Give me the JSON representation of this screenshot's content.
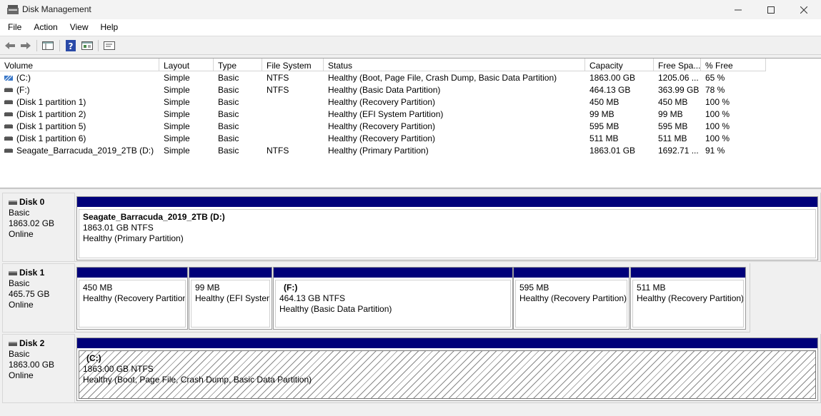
{
  "window": {
    "title": "Disk Management"
  },
  "menu": [
    "File",
    "Action",
    "View",
    "Help"
  ],
  "columns": [
    "Volume",
    "Layout",
    "Type",
    "File System",
    "Status",
    "Capacity",
    "Free Spa...",
    "% Free"
  ],
  "volumes": [
    {
      "volume": "(C:)",
      "layout": "Simple",
      "type": "Basic",
      "fs": "NTFS",
      "status": "Healthy (Boot, Page File, Crash Dump, Basic Data Partition)",
      "capacity": "1863.00 GB",
      "free": "1205.06 ...",
      "pct": "65 %",
      "icon": "striped-volume-icon"
    },
    {
      "volume": "(F:)",
      "layout": "Simple",
      "type": "Basic",
      "fs": "NTFS",
      "status": "Healthy (Basic Data Partition)",
      "capacity": "464.13 GB",
      "free": "363.99 GB",
      "pct": "78 %",
      "icon": "volume-icon"
    },
    {
      "volume": "(Disk 1 partition 1)",
      "layout": "Simple",
      "type": "Basic",
      "fs": "",
      "status": "Healthy (Recovery Partition)",
      "capacity": "450 MB",
      "free": "450 MB",
      "pct": "100 %",
      "icon": "volume-icon"
    },
    {
      "volume": "(Disk 1 partition 2)",
      "layout": "Simple",
      "type": "Basic",
      "fs": "",
      "status": "Healthy (EFI System Partition)",
      "capacity": "99 MB",
      "free": "99 MB",
      "pct": "100 %",
      "icon": "volume-icon"
    },
    {
      "volume": "(Disk 1 partition 5)",
      "layout": "Simple",
      "type": "Basic",
      "fs": "",
      "status": "Healthy (Recovery Partition)",
      "capacity": "595 MB",
      "free": "595 MB",
      "pct": "100 %",
      "icon": "volume-icon"
    },
    {
      "volume": "(Disk 1 partition 6)",
      "layout": "Simple",
      "type": "Basic",
      "fs": "",
      "status": "Healthy (Recovery Partition)",
      "capacity": "511 MB",
      "free": "511 MB",
      "pct": "100 %",
      "icon": "volume-icon"
    },
    {
      "volume": "Seagate_Barracuda_2019_2TB (D:)",
      "layout": "Simple",
      "type": "Basic",
      "fs": "NTFS",
      "status": "Healthy (Primary Partition)",
      "capacity": "1863.01 GB",
      "free": "1692.71 ...",
      "pct": "91 %",
      "icon": "volume-icon"
    }
  ],
  "disks": [
    {
      "name": "Disk 0",
      "type": "Basic",
      "size": "1863.02 GB",
      "state": "Online",
      "partitions": [
        {
          "title": "Seagate_Barracuda_2019_2TB  (D:)",
          "line1": "1863.01 GB NTFS",
          "line2": "Healthy (Primary Partition)"
        }
      ]
    },
    {
      "name": "Disk 1",
      "type": "Basic",
      "size": "465.75 GB",
      "state": "Online",
      "partitions": [
        {
          "title": "",
          "line1": "450 MB",
          "line2": "Healthy (Recovery Partition)"
        },
        {
          "title": "",
          "line1": "99 MB",
          "line2": "Healthy (EFI System Partition)"
        },
        {
          "title": "(F:)",
          "line1": "464.13 GB NTFS",
          "line2": "Healthy (Basic Data Partition)"
        },
        {
          "title": "",
          "line1": "595 MB",
          "line2": "Healthy (Recovery Partition)"
        },
        {
          "title": "",
          "line1": "511 MB",
          "line2": "Healthy (Recovery Partition)"
        }
      ]
    },
    {
      "name": "Disk 2",
      "type": "Basic",
      "size": "1863.00 GB",
      "state": "Online",
      "partitions": [
        {
          "title": "(C:)",
          "line1": "1863.00 GB NTFS",
          "line2": "Healthy (Boot, Page File, Crash Dump, Basic Data Partition)"
        }
      ]
    }
  ],
  "colors": {
    "partition_bar": "#00007a",
    "selected_hatch": "#8a8a8a"
  }
}
